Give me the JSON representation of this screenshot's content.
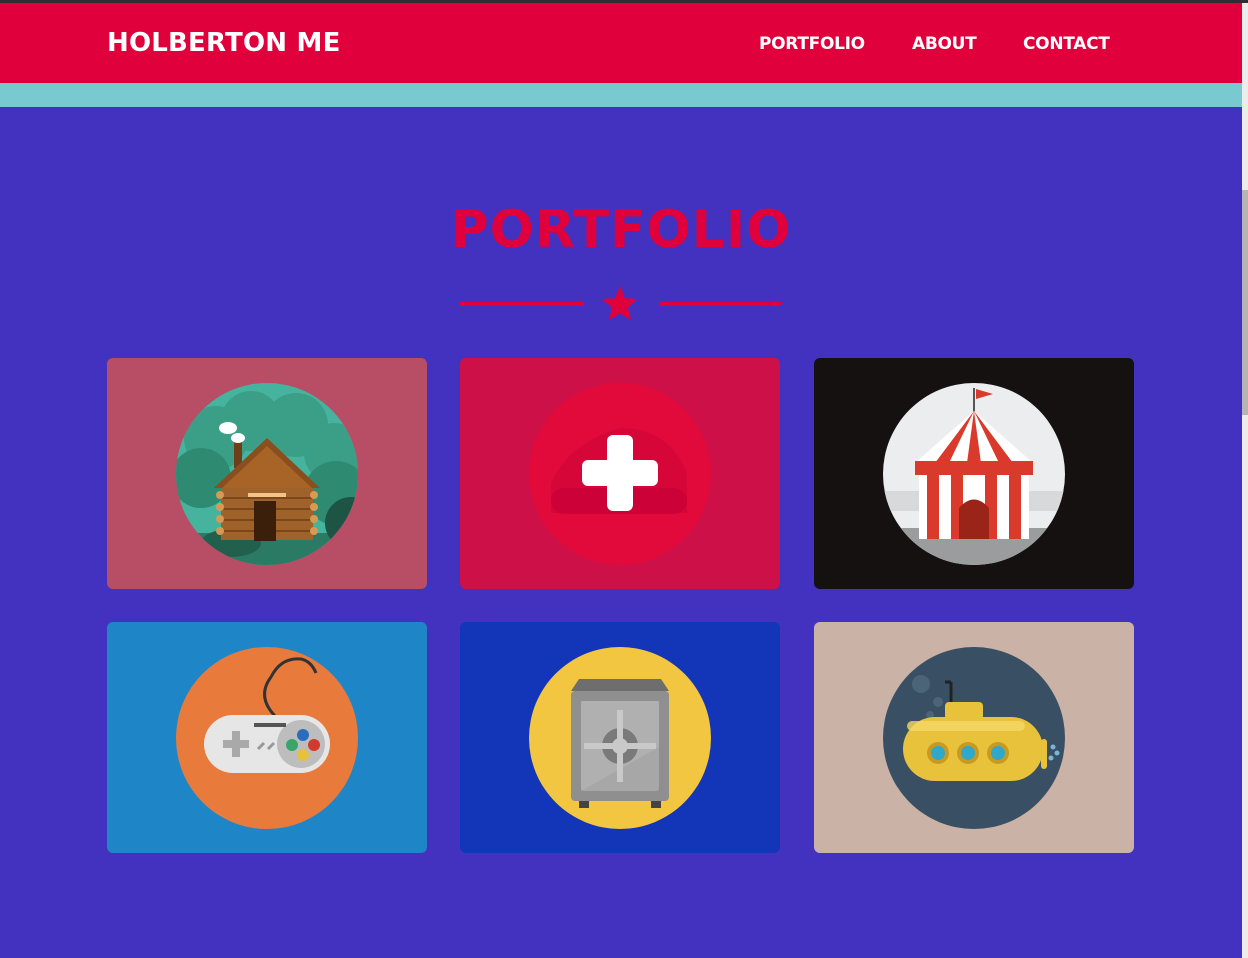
{
  "navbar": {
    "brand": "HOLBERTON ME",
    "links": [
      "PORTFOLIO",
      "ABOUT",
      "CONTACT"
    ]
  },
  "portfolio": {
    "heading": "PORTFOLIO",
    "divider_icon": "star-icon",
    "items": [
      {
        "icon": "log-cabin-icon",
        "background": "#b84e65"
      },
      {
        "icon": "plus-icon",
        "background": "#cd1047"
      },
      {
        "icon": "circus-tent-icon",
        "background": "#151110"
      },
      {
        "icon": "game-controller-icon",
        "background": "#1e86c6"
      },
      {
        "icon": "safe-icon",
        "background": "#1336b8"
      },
      {
        "icon": "submarine-icon",
        "background": "#cab2a6"
      }
    ]
  },
  "colors": {
    "accent": "#e0003b",
    "page_background": "#4232bf",
    "teal_band": "#79c9d0"
  }
}
